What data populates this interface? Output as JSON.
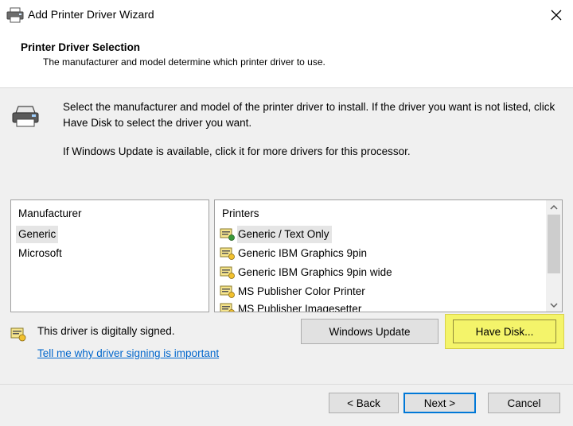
{
  "window": {
    "title": "Add Printer Driver Wizard",
    "icon": "printer-icon",
    "close_icon": "close-icon"
  },
  "header": {
    "title": "Printer Driver Selection",
    "subtitle": "The manufacturer and model determine which printer driver to use."
  },
  "instructions": {
    "line1": "Select the manufacturer and model of the printer driver to install. If the driver you want is not listed, click Have Disk to select the driver you want.",
    "line2": "If Windows Update is available, click it for more drivers for this processor."
  },
  "manufacturer_list": {
    "header": "Manufacturer",
    "items": [
      "Generic",
      "Microsoft"
    ],
    "selected": "Generic"
  },
  "printers_list": {
    "header": "Printers",
    "items": [
      "Generic / Text Only",
      "Generic IBM Graphics 9pin",
      "Generic IBM Graphics 9pin wide",
      "MS Publisher Color Printer",
      "MS Publisher Imagesetter"
    ],
    "selected": "Generic / Text Only"
  },
  "signing": {
    "status": "This driver is digitally signed.",
    "link": "Tell me why driver signing is important"
  },
  "buttons": {
    "windows_update": "Windows Update",
    "have_disk": "Have Disk...",
    "back": "< Back",
    "next": "Next >",
    "cancel": "Cancel"
  },
  "colors": {
    "highlight": "#f4f46a",
    "link": "#0066cc",
    "default_button_border": "#0078d7"
  }
}
